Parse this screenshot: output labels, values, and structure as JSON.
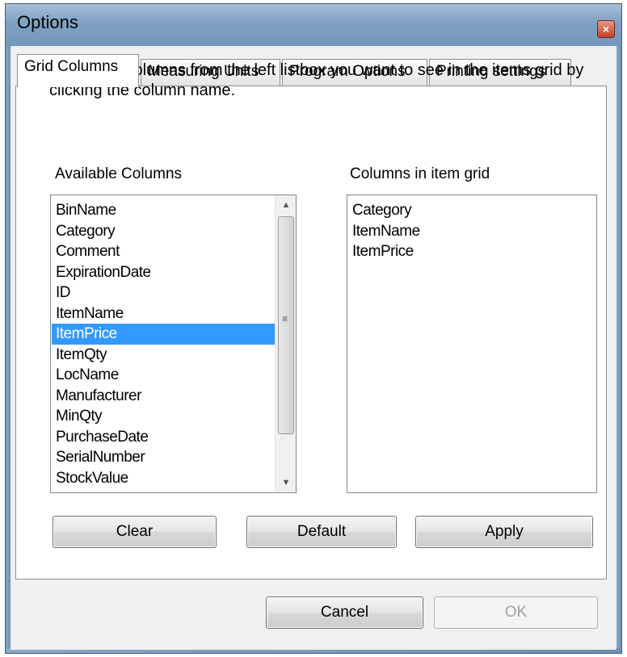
{
  "window": {
    "title": "Options",
    "close_icon": "×"
  },
  "tabs": [
    {
      "label": "Grid Columns",
      "active": true
    },
    {
      "label": "Measuring Units",
      "active": false
    },
    {
      "label": "Program Options",
      "active": false
    },
    {
      "label": "Printing settings",
      "active": false
    }
  ],
  "grid_columns": {
    "instructions": "Select the columns from the left listbox you want to see in the items grid by clicking the column name.",
    "available_label": "Available Columns",
    "selected_label": "Columns in item grid",
    "available": [
      "BinName",
      "Category",
      "Comment",
      "ExpirationDate",
      "ID",
      "ItemName",
      "ItemPrice",
      "ItemQty",
      "LocName",
      "Manufacturer",
      "MinQty",
      "PurchaseDate",
      "SerialNumber",
      "StockValue"
    ],
    "available_selected": "ItemPrice",
    "in_grid": [
      "Category",
      "ItemName",
      "ItemPrice"
    ],
    "clear_label": "Clear",
    "default_label": "Default",
    "apply_label": "Apply"
  },
  "footer": {
    "cancel_label": "Cancel",
    "ok_label": "OK",
    "ok_enabled": false
  },
  "colors": {
    "selection": "#3399ff",
    "titlebar": "#7fa0c2"
  }
}
